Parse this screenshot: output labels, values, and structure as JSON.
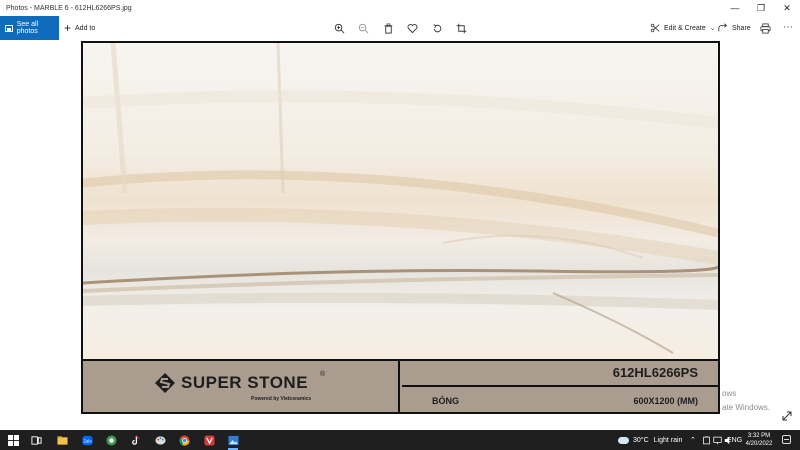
{
  "window": {
    "title": "Photos - MARBLE 6 - 612HL6266PS.jpg"
  },
  "toolbar": {
    "see_all_label": "See all photos",
    "add_to_label": "Add to",
    "edit_create_label": "Edit & Create",
    "share_label": "Share",
    "icons": [
      "zoom-in-icon",
      "zoom-out-icon",
      "delete-icon",
      "heart-icon",
      "rotate-icon",
      "crop-icon",
      "print-icon"
    ]
  },
  "photo": {
    "brand_name": "SUPER STONE",
    "brand_registered": "®",
    "brand_subtitle": "Powered by Vietceramics",
    "product_code": "612HL6266PS",
    "finish": "BÓNG",
    "size": "600X1200 (MM)"
  },
  "watermark": {
    "line1": "ows",
    "line2": "ate Windows."
  },
  "taskbar": {
    "weather_temp": "30°C",
    "weather_condition": "Light rain",
    "language": "ENG",
    "time": "3:32 PM",
    "date": "4/20/2022"
  },
  "colors": {
    "accent": "#0f6cbd",
    "label_strip": "#aa9d90",
    "taskbar": "#1f1f1f"
  }
}
